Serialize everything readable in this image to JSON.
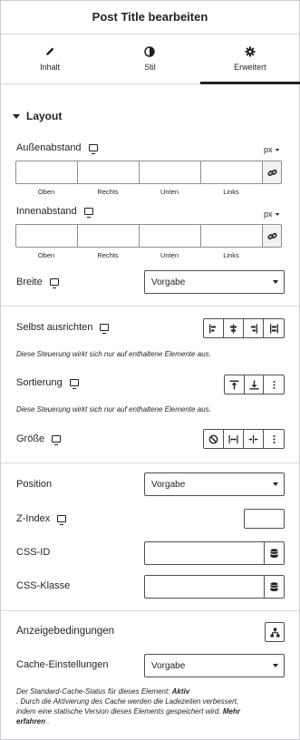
{
  "header": {
    "title": "Post Title bearbeiten"
  },
  "tabs": [
    {
      "label": "Inhalt",
      "icon": "pencil-icon"
    },
    {
      "label": "Stil",
      "icon": "contrast-icon"
    },
    {
      "label": "Erweitert",
      "icon": "gear-icon",
      "active": true
    }
  ],
  "section": {
    "title": "Layout"
  },
  "margin": {
    "label": "Außenabstand",
    "unit": "px",
    "sides": [
      "Oben",
      "Rechts",
      "Unten",
      "Links"
    ]
  },
  "padding": {
    "label": "Innenabstand",
    "unit": "px",
    "sides": [
      "Oben",
      "Rechts",
      "Unten",
      "Links"
    ]
  },
  "width": {
    "label": "Breite",
    "value": "Vorgabe"
  },
  "align_self": {
    "label": "Selbst ausrichten",
    "note": "Diese Steuerung wirkt sich nur auf enthaltene Elemente aus."
  },
  "order": {
    "label": "Sortierung",
    "note": "Diese Steuerung wirkt sich nur auf enthaltene Elemente aus."
  },
  "size": {
    "label": "Größe"
  },
  "position": {
    "label": "Position",
    "value": "Vorgabe"
  },
  "zindex": {
    "label": "Z-Index"
  },
  "css_id": {
    "label": "CSS-ID"
  },
  "css_class": {
    "label": "CSS-Klasse"
  },
  "display_conditions": {
    "label": "Anzeigebedingungen"
  },
  "cache": {
    "label": "Cache-Einstellungen",
    "value": "Vorgabe",
    "note_prefix": "Der Standard-Cache-Status für dieses Element: ",
    "note_status": "Aktiv",
    "note_line2": ". Durch die Aktivierung des Cache werden die Ladezeiten verbessert,",
    "note_line3": "indem eine statische Version dieses Elements gespeichert wird. ",
    "note_link_1": "Mehr",
    "note_link_2": "erfahren",
    "note_end": " ."
  },
  "colors": {
    "text": "#1f2124",
    "border": "#4c5056",
    "divider": "#d5d8dc"
  }
}
